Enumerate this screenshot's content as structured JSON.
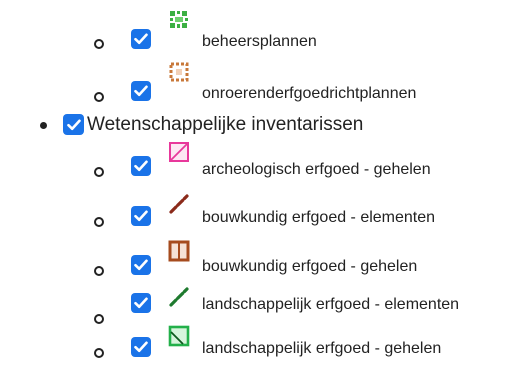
{
  "layers": {
    "items": [
      {
        "label": "beheersplannen",
        "checked": true,
        "icon": "beheersplannen-icon"
      },
      {
        "label": "onroerenderfgoedrichtplannen",
        "checked": true,
        "icon": "erfgoedrichtplannen-icon"
      },
      {
        "label": "Wetenschappelijke inventarissen",
        "checked": true
      },
      {
        "label": "archeologisch erfgoed - gehelen",
        "checked": true,
        "icon": "pink-hatched-square-icon"
      },
      {
        "label": "bouwkundig erfgoed - elementen",
        "checked": true,
        "icon": "dark-red-dashed-line-icon"
      },
      {
        "label": "bouwkundig erfgoed - gehelen",
        "checked": true,
        "icon": "brown-outlined-square-icon"
      },
      {
        "label": "landschappelijk erfgoed - elementen",
        "checked": true,
        "icon": "green-dashed-line-icon"
      },
      {
        "label": "landschappelijk erfgoed - gehelen",
        "checked": true,
        "icon": "green-hatched-square-icon"
      }
    ]
  },
  "colors": {
    "checkbox": "#1a73e8",
    "pink": "#e8389b",
    "dark_red": "#8b2a1a",
    "brown": "#a64b1e",
    "green": "#1e7a2e",
    "bright_green": "#23b04a"
  }
}
